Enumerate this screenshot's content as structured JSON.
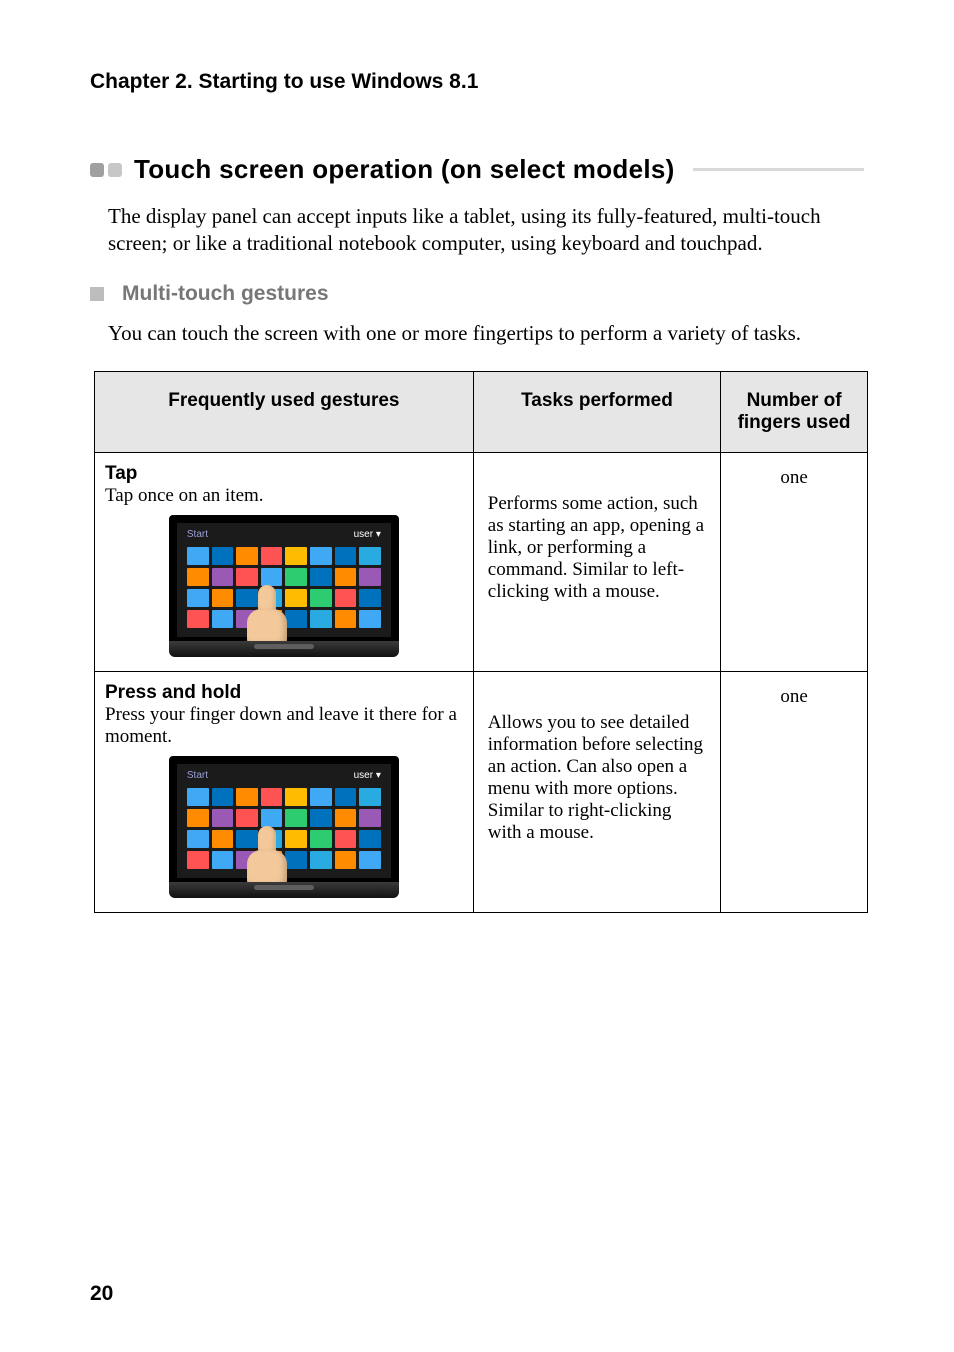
{
  "chapter_title": "Chapter 2. Starting to use Windows 8.1",
  "section_title": "Touch screen operation (on select models)",
  "intro_text": "The display panel can accept inputs like a tablet, using its fully-featured, multi-touch screen; or like a traditional notebook computer, using keyboard and touchpad.",
  "subsection_title": "Multi-touch gestures",
  "subsection_intro": "You can touch the screen with one or more fingertips to perform a variety of tasks.",
  "table": {
    "headers": {
      "gestures": "Frequently used gestures",
      "tasks": "Tasks performed",
      "fingers": "Number of fingers used"
    },
    "rows": [
      {
        "title": "Tap",
        "desc": "Tap once on an item.",
        "task": "Performs some action, such as starting an app, opening a link, or performing a command. Similar to left-clicking with a mouse.",
        "fingers": "one"
      },
      {
        "title": "Press and hold",
        "desc": "Press your finger down and leave it there for a moment.",
        "task": "Allows you to see detailed information before selecting an action. Can also open a menu with more options. Similar to right-clicking with a mouse.",
        "fingers": "one"
      }
    ]
  },
  "illustration": {
    "start_label": "Start",
    "user_hint": "user ▾",
    "tile_colors": [
      "#3fa9f5",
      "#0071bc",
      "#ff8c00",
      "#ff5252",
      "#ffbc00",
      "#3fa9f5",
      "#0071bc",
      "#29abe2",
      "#ff8c00",
      "#9b59b6",
      "#ff5252",
      "#3fa9f5",
      "#2ecc71",
      "#0071bc",
      "#ff8c00",
      "#9b59b6",
      "#3fa9f5",
      "#ff8c00",
      "#0071bc",
      "#29abe2",
      "#ffbc00",
      "#2ecc71",
      "#ff5252",
      "#0071bc",
      "#ff5252",
      "#3fa9f5",
      "#9b59b6",
      "#ff8c00",
      "#0071bc",
      "#29abe2",
      "#ff8c00",
      "#3fa9f5"
    ]
  },
  "page_number": "20"
}
